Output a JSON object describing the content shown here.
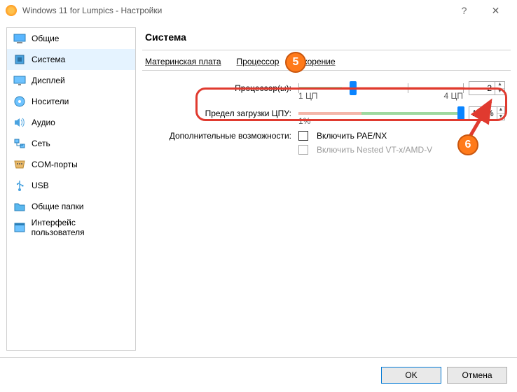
{
  "window": {
    "title": "Windows 11 for Lumpics - Настройки",
    "help": "?",
    "close": "✕"
  },
  "sidebar": {
    "items": [
      {
        "label": "Общие"
      },
      {
        "label": "Система"
      },
      {
        "label": "Дисплей"
      },
      {
        "label": "Носители"
      },
      {
        "label": "Аудио"
      },
      {
        "label": "Сеть"
      },
      {
        "label": "COM-порты"
      },
      {
        "label": "USB"
      },
      {
        "label": "Общие папки"
      },
      {
        "label": "Интерфейс пользователя"
      }
    ]
  },
  "main": {
    "title": "Система",
    "tabs": [
      {
        "label": "Материнская плата"
      },
      {
        "label": "Процессор"
      },
      {
        "label": "Ускорение"
      }
    ],
    "cpu": {
      "label": "Процессор(ы):",
      "value": "2",
      "min_label": "1 ЦП",
      "max_label": "4 ЦП"
    },
    "load": {
      "label": "Предел загрузки ЦПУ:",
      "value": "100%",
      "min_label": "1%"
    },
    "extras": {
      "label": "Дополнительные возможности:",
      "pae": "Включить PAE/NX",
      "nested": "Включить Nested VT-x/AMD-V"
    }
  },
  "footer": {
    "ok": "OK",
    "cancel": "Отмена"
  },
  "callouts": {
    "c5": "5",
    "c6": "6"
  }
}
